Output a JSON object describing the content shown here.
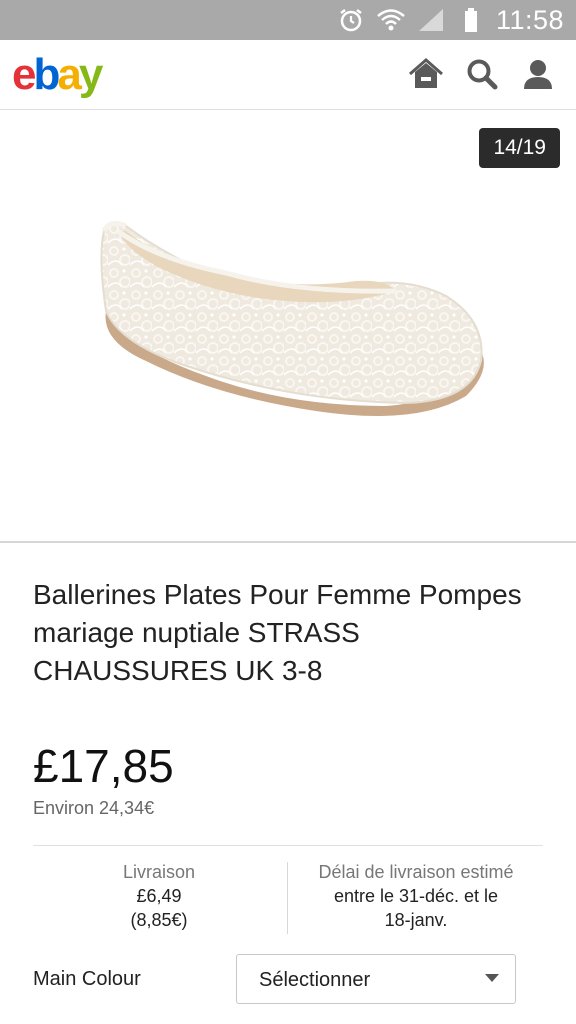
{
  "status_bar": {
    "time": "11:58",
    "icons": [
      "alarm-icon",
      "wifi-icon",
      "signal-icon",
      "battery-icon"
    ]
  },
  "header": {
    "logo": [
      "e",
      "b",
      "a",
      "y"
    ],
    "logo_colors": [
      "#e53238",
      "#0064d2",
      "#f5af02",
      "#86b817"
    ],
    "actions": [
      "home-icon",
      "search-icon",
      "user-icon"
    ]
  },
  "gallery": {
    "counter": "14/19"
  },
  "product": {
    "title": "Ballerines Plates Pour Femme Pompes mariage nuptiale STRASS CHAUSSURES UK 3-8",
    "price": "£17,85",
    "price_approx": "Environ 24,34€"
  },
  "shipping": {
    "delivery_label": "Livraison",
    "delivery_value_line1": "£6,49",
    "delivery_value_line2": "(8,85€)",
    "estimate_label": "Délai de livraison estimé",
    "estimate_value_line1": "entre le 31-déc. et le",
    "estimate_value_line2": "18-janv."
  },
  "options": {
    "colour_label": "Main Colour",
    "colour_select_value": "Sélectionner"
  }
}
